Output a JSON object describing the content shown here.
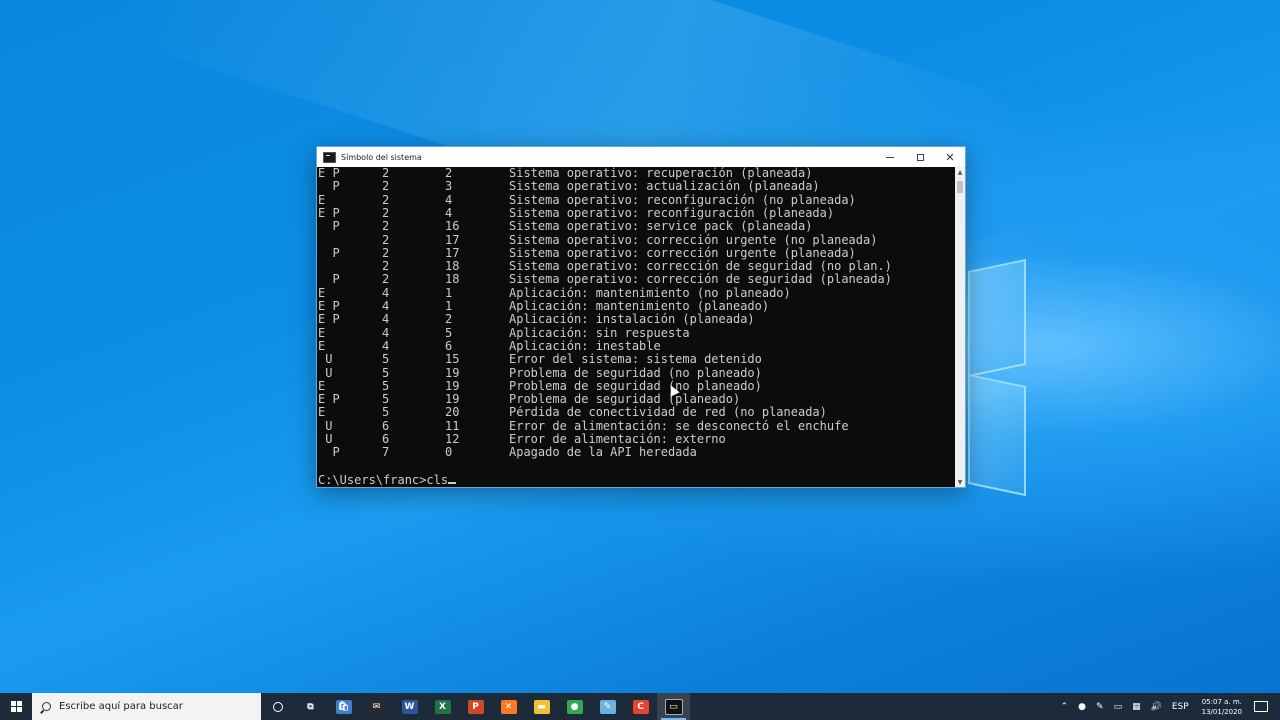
{
  "window": {
    "title": "Símbolo del sistema",
    "controls": {
      "minimize": "—",
      "maximize": "☐",
      "close": "✕"
    }
  },
  "console": {
    "rows": [
      [
        "E P",
        "2",
        "2",
        "Sistema operativo: recuperación (planeada)"
      ],
      [
        "  P",
        "2",
        "3",
        "Sistema operativo: actualización (planeada)"
      ],
      [
        "E",
        "2",
        "4",
        "Sistema operativo: reconfiguración (no planeada)"
      ],
      [
        "E P",
        "2",
        "4",
        "Sistema operativo: reconfiguración (planeada)"
      ],
      [
        "  P",
        "2",
        "16",
        "Sistema operativo: service pack (planeada)"
      ],
      [
        "",
        "2",
        "17",
        "Sistema operativo: corrección urgente (no planeada)"
      ],
      [
        "  P",
        "2",
        "17",
        "Sistema operativo: corrección urgente (planeada)"
      ],
      [
        "",
        "2",
        "18",
        "Sistema operativo: corrección de seguridad (no plan.)"
      ],
      [
        "  P",
        "2",
        "18",
        "Sistema operativo: corrección de seguridad (planeada)"
      ],
      [
        "E",
        "4",
        "1",
        "Aplicación: mantenimiento (no planeado)"
      ],
      [
        "E P",
        "4",
        "1",
        "Aplicación: mantenimiento (planeado)"
      ],
      [
        "E P",
        "4",
        "2",
        "Aplicación: instalación (planeada)"
      ],
      [
        "E",
        "4",
        "5",
        "Aplicación: sin respuesta"
      ],
      [
        "E",
        "4",
        "6",
        "Aplicación: inestable"
      ],
      [
        " U",
        "5",
        "15",
        "Error del sistema: sistema detenido"
      ],
      [
        " U",
        "5",
        "19",
        "Problema de seguridad (no planeado)"
      ],
      [
        "E",
        "5",
        "19",
        "Problema de seguridad (no planeado)"
      ],
      [
        "E P",
        "5",
        "19",
        "Problema de seguridad (planeado)"
      ],
      [
        "E",
        "5",
        "20",
        "Pérdida de conectividad de red (no planeada)"
      ],
      [
        " U",
        "6",
        "11",
        "Error de alimentación: se desconectó el enchufe"
      ],
      [
        " U",
        "6",
        "12",
        "Error de alimentación: externo"
      ],
      [
        "  P",
        "7",
        "0",
        "Apagado de la API heredada"
      ]
    ],
    "prompt": "C:\\Users\\franc>cls"
  },
  "taskbar": {
    "search_placeholder": "Escribe aquí para buscar",
    "apps": [
      {
        "name": "cortana-icon",
        "glyph": ""
      },
      {
        "name": "task-view-icon",
        "glyph": "⧉"
      },
      {
        "name": "store-icon",
        "glyph": "🛍"
      },
      {
        "name": "mail-icon",
        "glyph": "✉"
      },
      {
        "name": "word-icon",
        "glyph": "W"
      },
      {
        "name": "excel-icon",
        "glyph": "X"
      },
      {
        "name": "powerpoint-icon",
        "glyph": "P"
      },
      {
        "name": "xampp-icon",
        "glyph": "✕"
      },
      {
        "name": "file-explorer-icon",
        "glyph": "▬"
      },
      {
        "name": "chrome-icon",
        "glyph": "●"
      },
      {
        "name": "notepad-icon",
        "glyph": "✎"
      },
      {
        "name": "codeblocks-icon",
        "glyph": "C"
      },
      {
        "name": "cmd-icon",
        "glyph": "▭"
      }
    ],
    "tray": {
      "language": "ESP",
      "time": "05:07 a. m.",
      "date": "13/01/2020"
    }
  },
  "colors": {
    "console_bg": "#0c0c0c",
    "console_fg": "#cccccc",
    "taskbar_bg": "#1d2a3a",
    "desktop_blue": "#0b8ee6"
  }
}
